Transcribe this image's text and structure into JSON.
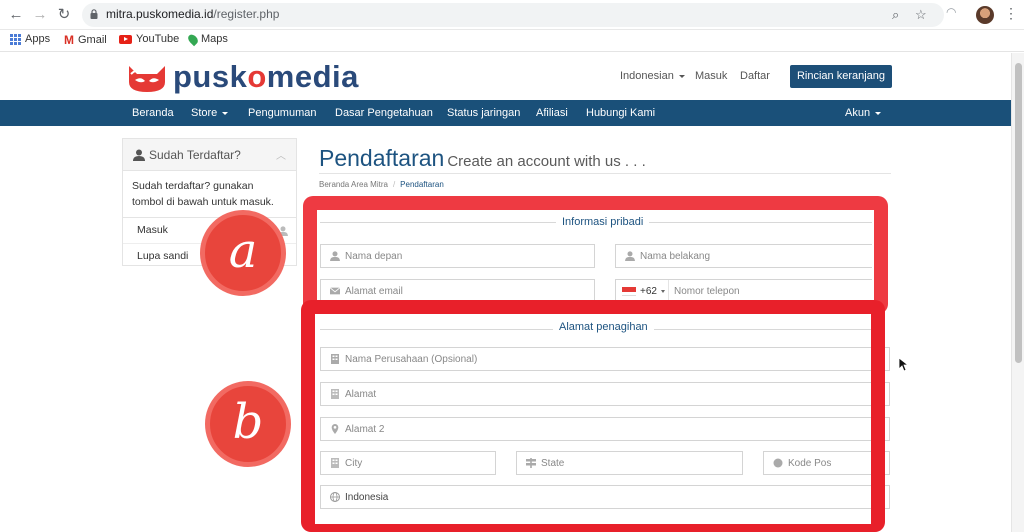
{
  "browser": {
    "url_host": "mitra.puskomedia.id",
    "url_path": "/register.php",
    "bookmarks": [
      "Apps",
      "Gmail",
      "YouTube",
      "Maps"
    ]
  },
  "header": {
    "logo_prefix": "pusk",
    "logo_o": "o",
    "logo_suffix": "media",
    "language": "Indonesian",
    "login": "Masuk",
    "register": "Daftar",
    "cart_button": "Rincian keranjang"
  },
  "nav": {
    "items": [
      "Beranda",
      "Store",
      "Pengumuman",
      "Dasar Pengetahuan",
      "Status jaringan",
      "Afiliasi",
      "Hubungi Kami"
    ],
    "account": "Akun"
  },
  "sidebar": {
    "title": "Sudah Terdaftar?",
    "body": "Sudah terdaftar? gunakan tombol di bawah untuk masuk.",
    "links": [
      "Masuk",
      "Lupa sandi"
    ]
  },
  "main": {
    "title": "Pendaftaran",
    "subtitle": "Create an account with us . . .",
    "breadcrumb": [
      "Beranda Area Mitra",
      "Pendaftaran"
    ],
    "personal": {
      "legend": "Informasi pribadi",
      "first_name": "Nama depan",
      "last_name": "Nama belakang",
      "email": "Alamat email",
      "dial_code": "+62",
      "phone": "Nomor telepon"
    },
    "billing": {
      "legend": "Alamat penagihan",
      "company": "Nama Perusahaan (Opsional)",
      "address": "Alamat",
      "address2": "Alamat 2",
      "city": "City",
      "state": "State",
      "postcode": "Kode Pos",
      "country": "Indonesia"
    }
  },
  "annotations": {
    "a": "a",
    "b": "b"
  },
  "colors": {
    "brand_blue": "#1a5079",
    "annotation_red": "#e8202a"
  }
}
